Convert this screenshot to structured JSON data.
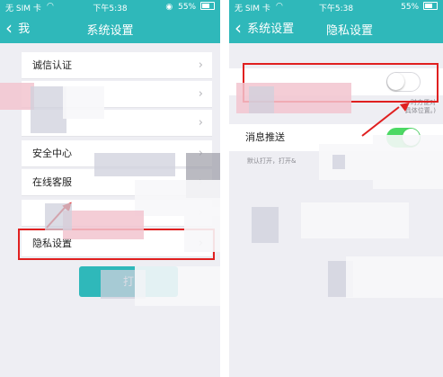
{
  "status": {
    "carrier": "无 SIM 卡",
    "wifi_icon": "wifi-icon",
    "time": "下午5:38",
    "battery": "55%"
  },
  "left": {
    "back_label": "我",
    "title": "系统设置",
    "rows": [
      "诚信认证",
      "",
      "",
      "安全中心",
      "在线客服",
      "",
      "隐私设置"
    ],
    "button_label": "打"
  },
  "right": {
    "back_label": "系统设置",
    "title": "隐私设置",
    "location_desc": "时方便对\n具体位置。)",
    "push_label": "消息推送",
    "push_desc": "默认打开，打开&",
    "location_toggle": false,
    "push_toggle": true
  },
  "colors": {
    "teal": "#2fb8ba",
    "highlight": "#e02020",
    "toggle_on": "#4cd964"
  }
}
